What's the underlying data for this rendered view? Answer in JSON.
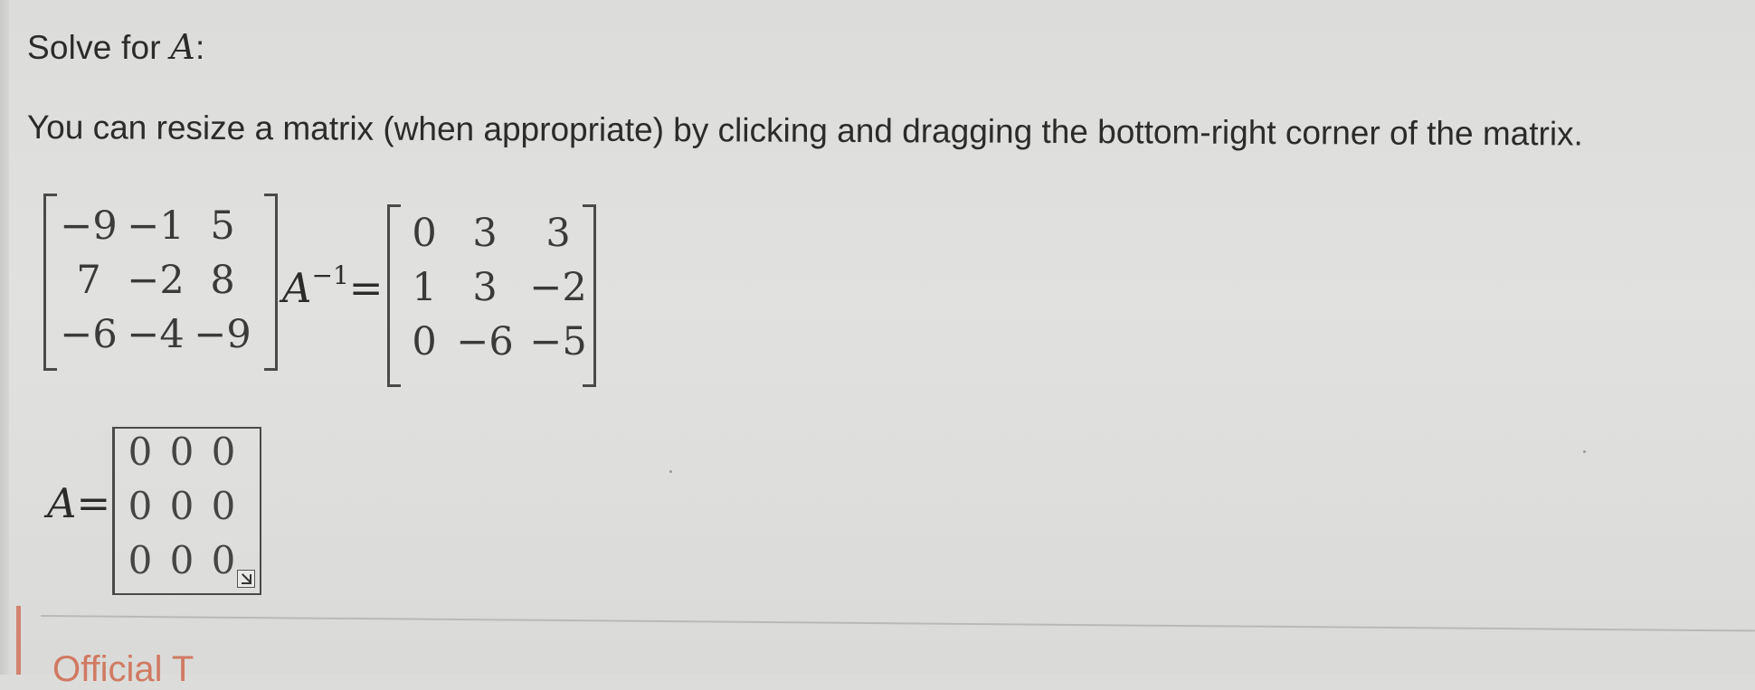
{
  "prompt": {
    "text": "Solve for ",
    "variable": "A",
    "colon": ":"
  },
  "instruction": "You can resize a matrix (when appropriate) by clicking and dragging the bottom-right corner of the matrix.",
  "equation": {
    "left_matrix": [
      [
        "−9",
        "−1",
        "5"
      ],
      [
        "7",
        "−2",
        "8"
      ],
      [
        "−6",
        "−4",
        "−9"
      ]
    ],
    "inverse_symbol": "A",
    "inverse_exponent": "−1",
    "equals": "=",
    "right_matrix": [
      [
        "0",
        "3",
        "3"
      ],
      [
        "1",
        "3",
        "−2"
      ],
      [
        "0",
        "−6",
        "−5"
      ]
    ]
  },
  "answer": {
    "label": "A=",
    "matrix": [
      [
        "0",
        "0",
        "0"
      ],
      [
        "0",
        "0",
        "0"
      ],
      [
        "0",
        "0",
        "0"
      ]
    ]
  },
  "footer": {
    "text": "Official T"
  },
  "colors": {
    "accent": "#d07a62",
    "background": "#dededc"
  }
}
